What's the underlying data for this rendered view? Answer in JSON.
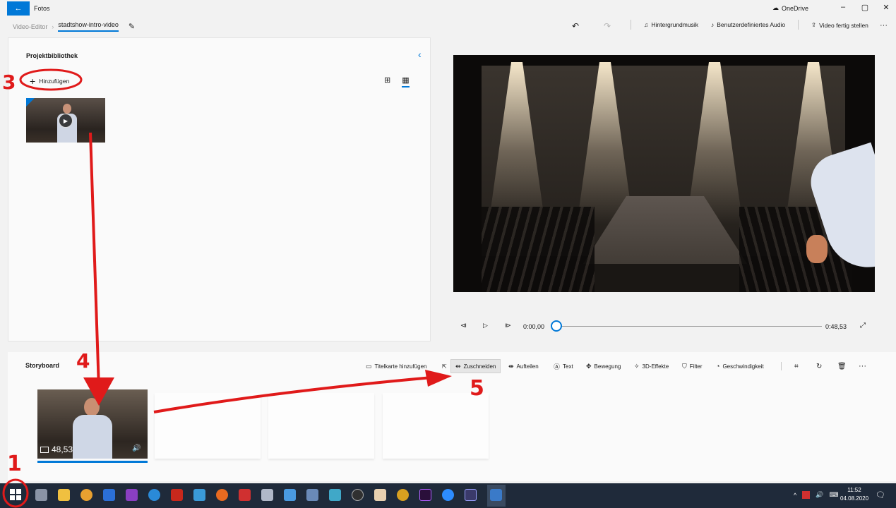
{
  "window": {
    "app_title": "Fotos",
    "onedrive_label": "OneDrive",
    "controls": [
      "–",
      "▢",
      "✕"
    ]
  },
  "breadcrumb": {
    "root": "Video-Editor",
    "current": "stadtshow-intro-video"
  },
  "top_actions": {
    "background_music": "Hintergrundmusik",
    "custom_audio": "Benutzerdefiniertes Audio",
    "finish_video": "Video fertig stellen",
    "more": "···"
  },
  "library": {
    "title": "Projektbibliothek",
    "add_label": "Hinzufügen"
  },
  "playback": {
    "current_time": "0:00,00",
    "total_time": "0:48,53",
    "progress": 0
  },
  "storyboard": {
    "title": "Storyboard",
    "tools": {
      "title_card": "Titelkarte hinzufügen",
      "trim": "Zuschneiden",
      "split": "Aufteilen",
      "text": "Text",
      "motion": "Bewegung",
      "effects_3d": "3D-Effekte",
      "filter": "Filter",
      "speed": "Geschwindigkeit",
      "more": "···"
    },
    "clip": {
      "duration": "48,53"
    }
  },
  "taskbar": {
    "time": "11:52",
    "date": "04.08.2020"
  },
  "annotations": {
    "step1": "1",
    "step3": "3",
    "step4": "4",
    "step5": "5"
  },
  "colors": {
    "accent": "#0078d7",
    "annotation_red": "#e01a1a",
    "taskbar": "#1f2a3a"
  }
}
